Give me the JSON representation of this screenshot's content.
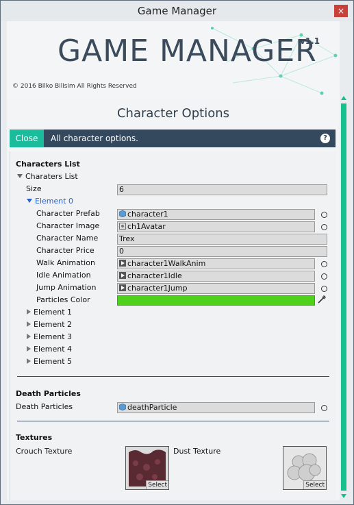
{
  "window": {
    "title": "Game Manager",
    "close_glyph": "×"
  },
  "banner": {
    "logo": "GAME MANAGER",
    "version": "v1.1",
    "copyright": "© 2016 Bilko Bilisim All Rights Reserved"
  },
  "page": {
    "title": "Character Options"
  },
  "topbar": {
    "close_label": "Close",
    "description": "All character options.",
    "help_glyph": "?"
  },
  "characters": {
    "section_label": "Characters List",
    "list_label": "Charaters List",
    "size_label": "Size",
    "size_value": "6",
    "element0": {
      "label": "Element 0",
      "prefab_label": "Character Prefab",
      "prefab_value": "character1",
      "image_label": "Character Image",
      "image_value": "ch1Avatar",
      "name_label": "Character Name",
      "name_value": "Trex",
      "price_label": "Character Price",
      "price_value": "0",
      "walk_label": "Walk Animation",
      "walk_value": "character1WalkAnim",
      "idle_label": "Idle Animation",
      "idle_value": "character1Idle",
      "jump_label": "Jump Animation",
      "jump_value": "character1Jump",
      "particles_label": "Particles Color",
      "particles_color": "#4fd11c"
    },
    "collapsed": [
      "Element 1",
      "Element 2",
      "Element 3",
      "Element 4",
      "Element 5"
    ]
  },
  "death": {
    "section_label": "Death Particles",
    "field_label": "Death Particles",
    "field_value": "deathParticle"
  },
  "textures": {
    "section_label": "Textures",
    "crouch_label": "Crouch Texture",
    "dust_label": "Dust Texture",
    "select_label": "Select"
  },
  "colors": {
    "accent": "#1abc9c",
    "topbar": "#34495e",
    "logo": "#3b4b5c",
    "close_red": "#c8413b"
  }
}
